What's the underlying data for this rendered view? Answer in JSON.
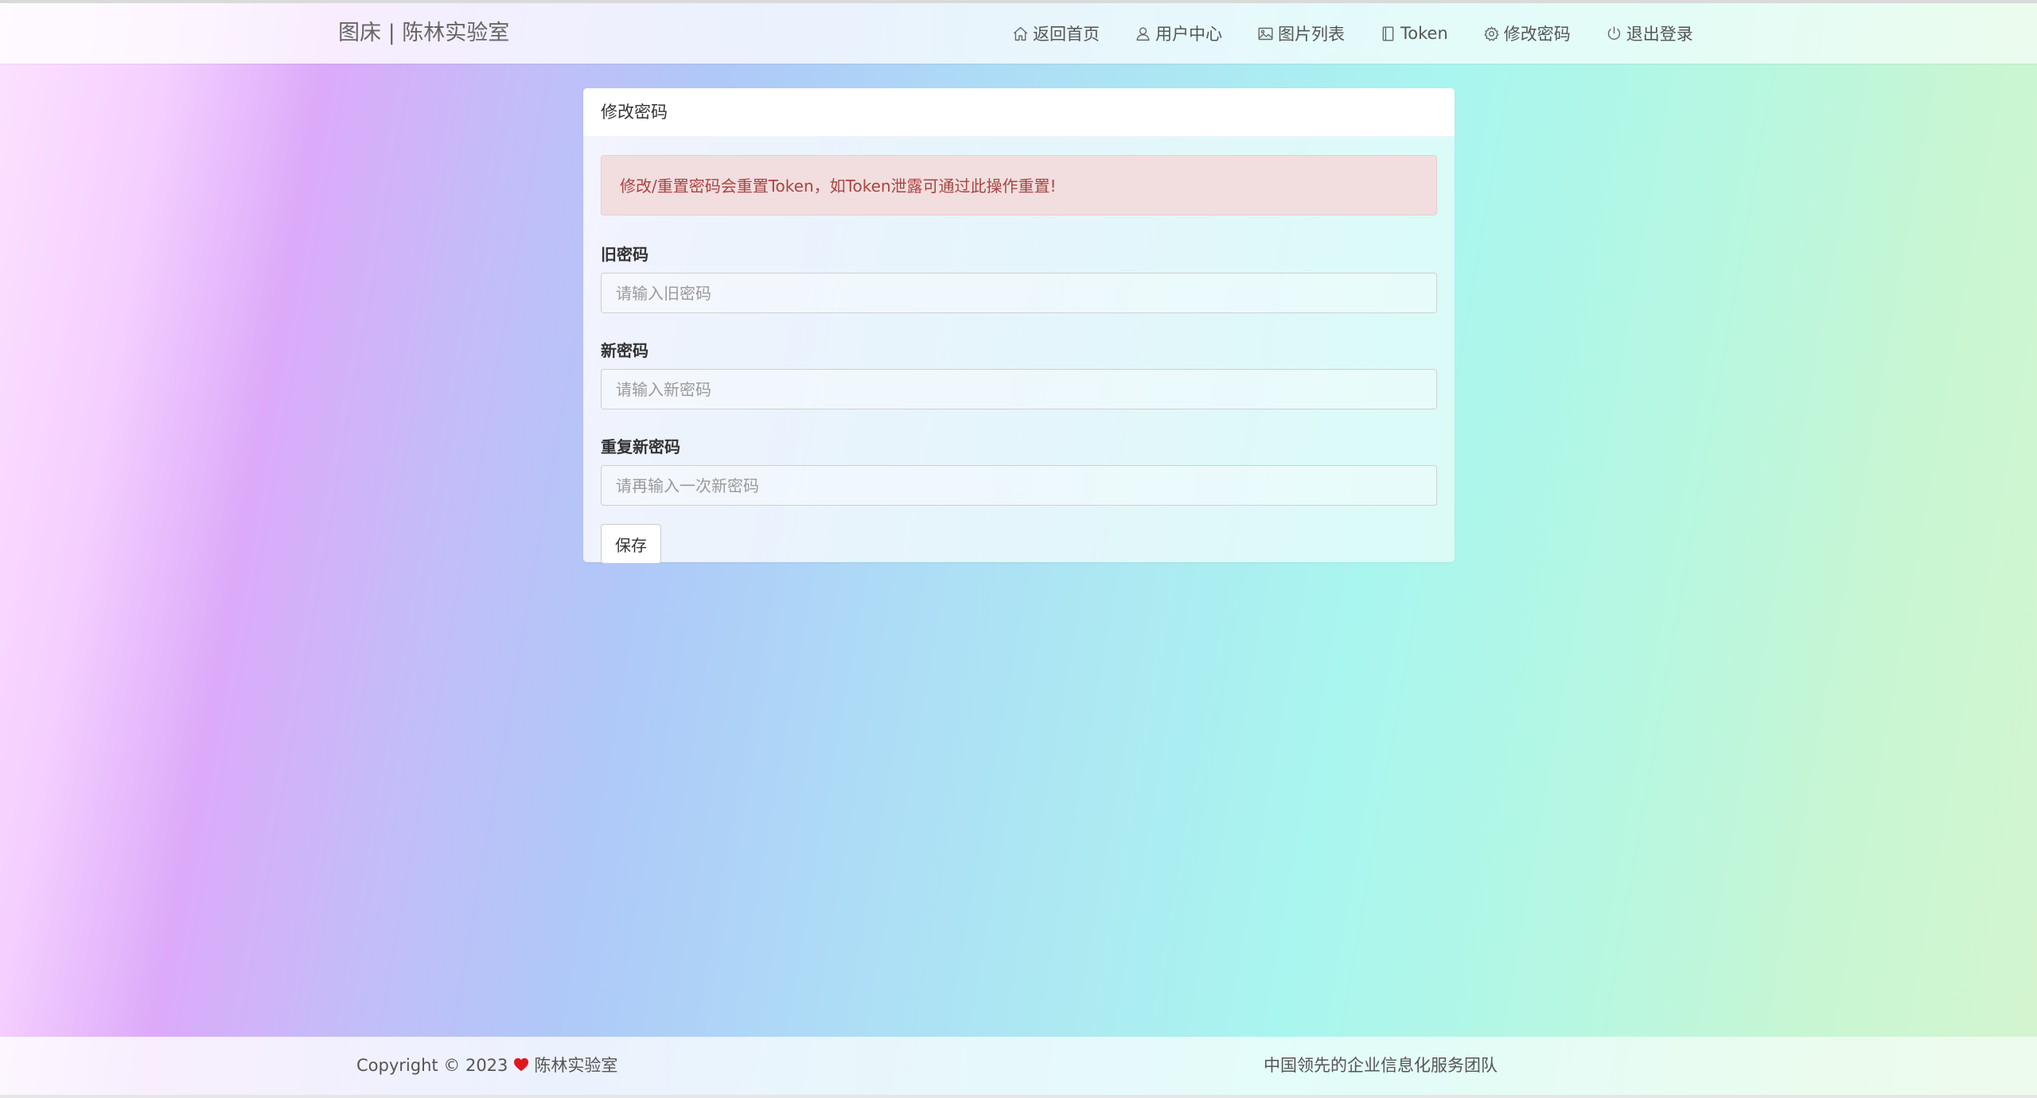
{
  "navbar": {
    "brand": "图床 | 陈林实验室",
    "items": [
      {
        "label": "返回首页",
        "icon": "home-icon"
      },
      {
        "label": "用户中心",
        "icon": "user-icon"
      },
      {
        "label": "图片列表",
        "icon": "image-icon"
      },
      {
        "label": "Token",
        "icon": "book-icon"
      },
      {
        "label": "修改密码",
        "icon": "gear-icon"
      },
      {
        "label": "退出登录",
        "icon": "power-icon"
      }
    ]
  },
  "card": {
    "title": "修改密码",
    "alert": "修改/重置密码会重置Token，如Token泄露可通过此操作重置!",
    "fields": [
      {
        "label": "旧密码",
        "placeholder": "请输入旧密码",
        "value": ""
      },
      {
        "label": "新密码",
        "placeholder": "请输入新密码",
        "value": ""
      },
      {
        "label": "重复新密码",
        "placeholder": "请再输入一次新密码",
        "value": ""
      }
    ],
    "save_label": "保存"
  },
  "footer": {
    "copyright_prefix": "Copyright © 2023",
    "copyright_org": "陈林实验室",
    "slogan": "中国领先的企业信息化服务团队",
    "heart_color": "#e0171f"
  },
  "colors": {
    "alert_background": "#f2dede",
    "alert_text": "#a94442"
  }
}
